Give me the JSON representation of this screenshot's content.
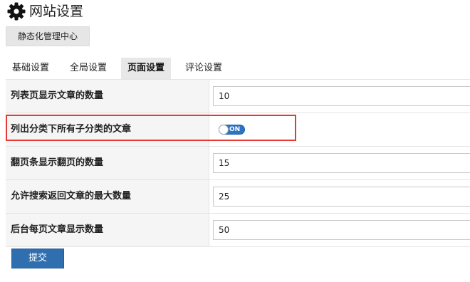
{
  "header": {
    "title": "网站设置",
    "icon": "gear-icon"
  },
  "static_center_button": "静态化管理中心",
  "tabs": [
    {
      "label": "基础设置",
      "active": false
    },
    {
      "label": "全局设置",
      "active": false
    },
    {
      "label": "页面设置",
      "active": true
    },
    {
      "label": "评论设置",
      "active": false
    }
  ],
  "form": {
    "rows": [
      {
        "label": "列表页显示文章的数量",
        "type": "input",
        "value": "10"
      },
      {
        "label": "列出分类下所有子分类的文章",
        "type": "toggle",
        "value": "ON"
      },
      {
        "label": "翻页条显示翻页的数量",
        "type": "input",
        "value": "15"
      },
      {
        "label": "允许搜索返回文章的最大数量",
        "type": "input",
        "value": "25"
      },
      {
        "label": "后台每页文章显示数量",
        "type": "input",
        "value": "50"
      }
    ]
  },
  "submit_label": "提交",
  "colors": {
    "accent": "#2f6fb0",
    "highlight": "#e53935",
    "toggle_on": "#2d73c4"
  }
}
